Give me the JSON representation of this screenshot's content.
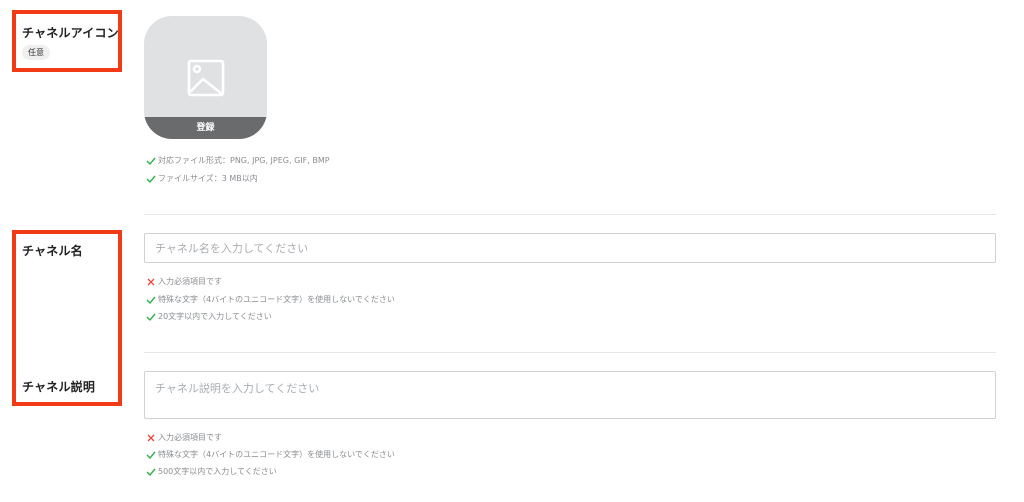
{
  "icon_section": {
    "label": "チャネルアイコン",
    "tag": "任意",
    "register_label": "登録",
    "notes": [
      {
        "status": "ok",
        "text": "対応ファイル形式：PNG, JPG, JPEG, GIF, BMP"
      },
      {
        "status": "ok",
        "text": "ファイルサイズ：3 MB以内"
      }
    ]
  },
  "name_section": {
    "label": "チャネル名",
    "placeholder": "チャネル名を入力してください",
    "value": "",
    "notes": [
      {
        "status": "error",
        "text": "入力必須項目です"
      },
      {
        "status": "ok",
        "text": "特殊な文字（4バイトのユニコード文字）を使用しないでください"
      },
      {
        "status": "ok",
        "text": "20文字以内で入力してください"
      }
    ]
  },
  "description_section": {
    "label": "チャネル説明",
    "placeholder": "チャネル説明を入力してください",
    "value": "",
    "notes": [
      {
        "status": "error",
        "text": "入力必須項目です"
      },
      {
        "status": "ok",
        "text": "特殊な文字（4バイトのユニコード文字）を使用しないでください"
      },
      {
        "status": "ok",
        "text": "500文字以内で入力してください"
      }
    ]
  },
  "colors": {
    "highlight_box": "#f03b16",
    "check_ok": "#2fb24a",
    "error_x": "#e8493a",
    "register_bar": "#6a6b6d",
    "icon_placeholder_bg": "#e0e1e3"
  },
  "icons": {
    "image_placeholder": "image-icon",
    "ok": "check-icon",
    "error": "cross-icon"
  }
}
